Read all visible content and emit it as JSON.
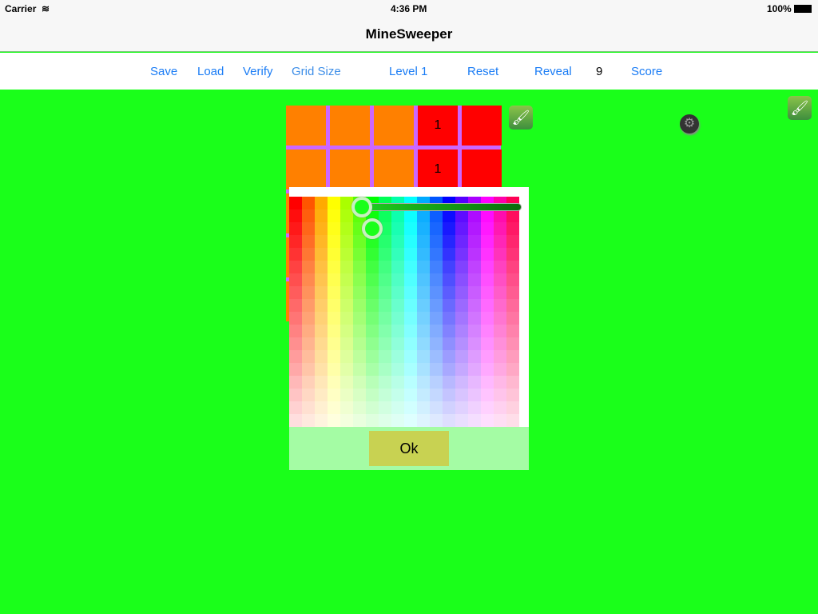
{
  "status": {
    "carrier": "Carrier",
    "time": "4:36 PM",
    "battery": "100%"
  },
  "nav": {
    "title": "MineSweeper"
  },
  "toolbar": {
    "save": "Save",
    "load": "Load",
    "verify": "Verify",
    "grid_size": "Grid Size",
    "grid_size_value": "5",
    "level": "Level 1",
    "reset": "Reset",
    "reveal": "Reveal",
    "reveal_count": "9",
    "score": "Score"
  },
  "board": {
    "rows": [
      [
        "",
        "",
        "",
        "1",
        ""
      ],
      [
        "",
        "",
        "",
        "1",
        ""
      ],
      [
        "",
        "",
        "",
        "",
        ""
      ],
      [
        "",
        "",
        "",
        "",
        ""
      ],
      [
        "",
        "",
        "",
        "",
        ""
      ]
    ],
    "colors": [
      [
        "#ff8000",
        "#ff8000",
        "#ff8000",
        "#ff0000",
        "#ff0000"
      ],
      [
        "#ff8000",
        "#ff8000",
        "#ff8000",
        "#ff0000",
        "#ff0000"
      ],
      [
        "#ff8000",
        "#ff8000",
        "#ff8000",
        "#ff0000",
        "#ff0000"
      ],
      [
        "#ff8000",
        "#ff8000",
        "#ff8000",
        "#ff0000",
        "#ff0000"
      ],
      [
        "#ff8000",
        "#ff8000",
        "#ff8000",
        "#ff0000",
        "#ff0000"
      ]
    ]
  },
  "color_picker": {
    "hues": [
      "#ff0000",
      "#ff5500",
      "#ffaa00",
      "#ffff00",
      "#aaff00",
      "#55ff00",
      "#00ff00",
      "#00ff55",
      "#00ffaa",
      "#00ffff",
      "#00aaff",
      "#0055ff",
      "#0000ff",
      "#5500ff",
      "#aa00ff",
      "#ff00ff",
      "#ff00aa",
      "#ff0055"
    ],
    "ok": "Ok",
    "brightness": 0.0
  }
}
